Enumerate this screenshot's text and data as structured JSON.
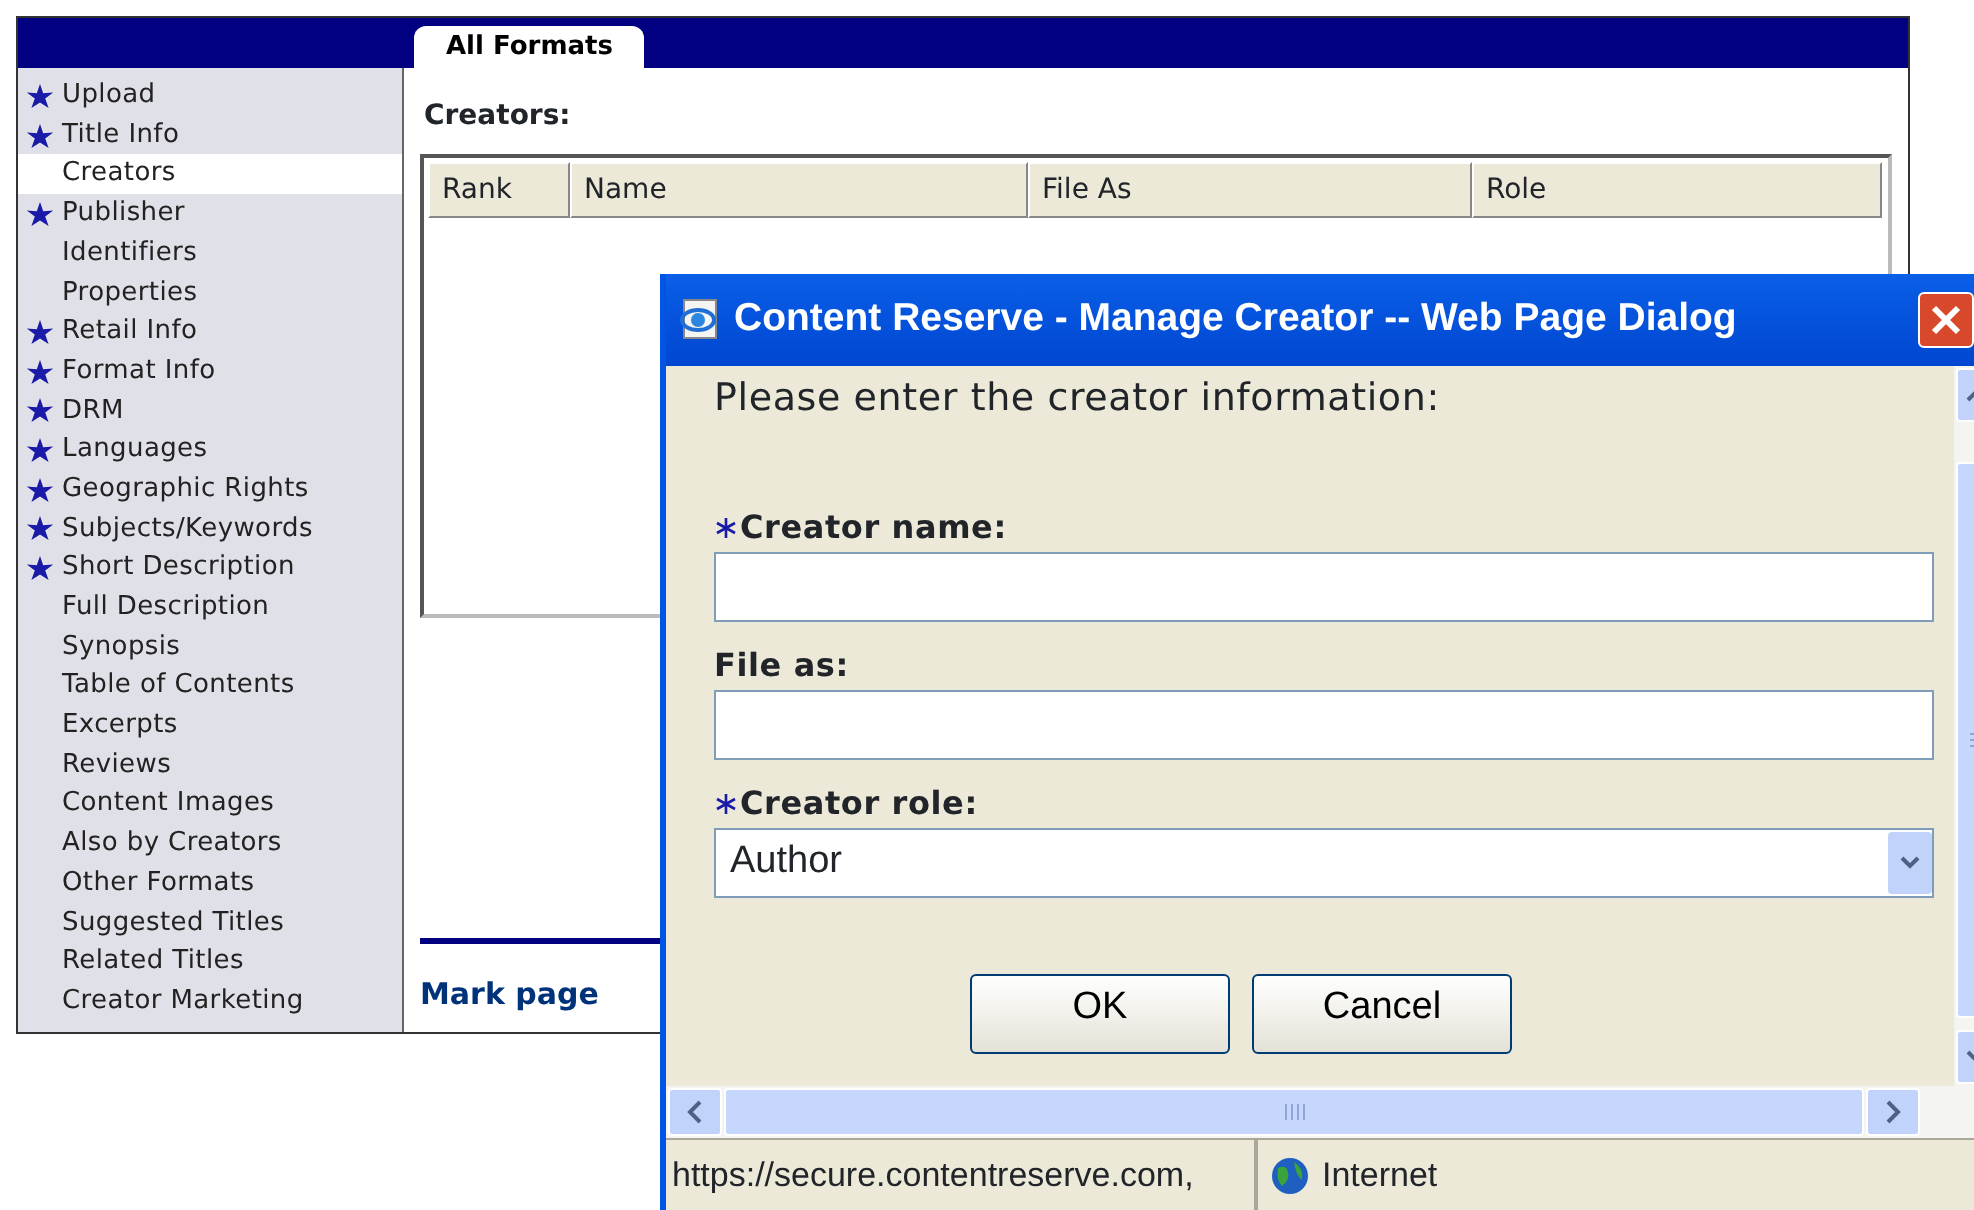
{
  "tab": {
    "label": "All Formats",
    "selected": true
  },
  "sidebar": {
    "items": [
      {
        "label": "Upload",
        "required": true,
        "selected": false
      },
      {
        "label": "Title Info",
        "required": true,
        "selected": false
      },
      {
        "label": "Creators",
        "required": false,
        "selected": true
      },
      {
        "label": "Publisher",
        "required": true,
        "selected": false
      },
      {
        "label": "Identifiers",
        "required": false,
        "selected": false
      },
      {
        "label": "Properties",
        "required": false,
        "selected": false
      },
      {
        "label": "Retail Info",
        "required": true,
        "selected": false
      },
      {
        "label": "Format Info",
        "required": true,
        "selected": false
      },
      {
        "label": "DRM",
        "required": true,
        "selected": false
      },
      {
        "label": "Languages",
        "required": true,
        "selected": false
      },
      {
        "label": "Geographic Rights",
        "required": true,
        "selected": false
      },
      {
        "label": "Subjects/Keywords",
        "required": true,
        "selected": false
      },
      {
        "label": "Short Description",
        "required": true,
        "selected": false
      },
      {
        "label": "Full Description",
        "required": false,
        "selected": false
      },
      {
        "label": "Synopsis",
        "required": false,
        "selected": false
      },
      {
        "label": "Table of Contents",
        "required": false,
        "selected": false
      },
      {
        "label": "Excerpts",
        "required": false,
        "selected": false
      },
      {
        "label": "Reviews",
        "required": false,
        "selected": false
      },
      {
        "label": "Content Images",
        "required": false,
        "selected": false
      },
      {
        "label": "Also by Creators",
        "required": false,
        "selected": false
      },
      {
        "label": "Other Formats",
        "required": false,
        "selected": false
      },
      {
        "label": "Suggested Titles",
        "required": false,
        "selected": false
      },
      {
        "label": "Related Titles",
        "required": false,
        "selected": false
      },
      {
        "label": "Creator Marketing",
        "required": false,
        "selected": false
      }
    ]
  },
  "section_title": "Creators:",
  "table": {
    "columns": [
      "Rank",
      "Name",
      "File As",
      "Role"
    ]
  },
  "footer_link": "Mark page",
  "dialog": {
    "title": "Content Reserve - Manage Creator -- Web Page Dialog",
    "prompt": "Please enter the creator information:",
    "fields": [
      {
        "kind": "text",
        "label": "Creator name:",
        "required": true
      },
      {
        "kind": "text",
        "label": "File as:",
        "required": false
      },
      {
        "kind": "select",
        "label": "Creator role:",
        "required": true,
        "value": "Author"
      }
    ],
    "buttons": [
      "OK",
      "Cancel"
    ],
    "status_bar": {
      "url": "https://secure.contentreserve.com,",
      "zone": "Internet"
    }
  }
}
